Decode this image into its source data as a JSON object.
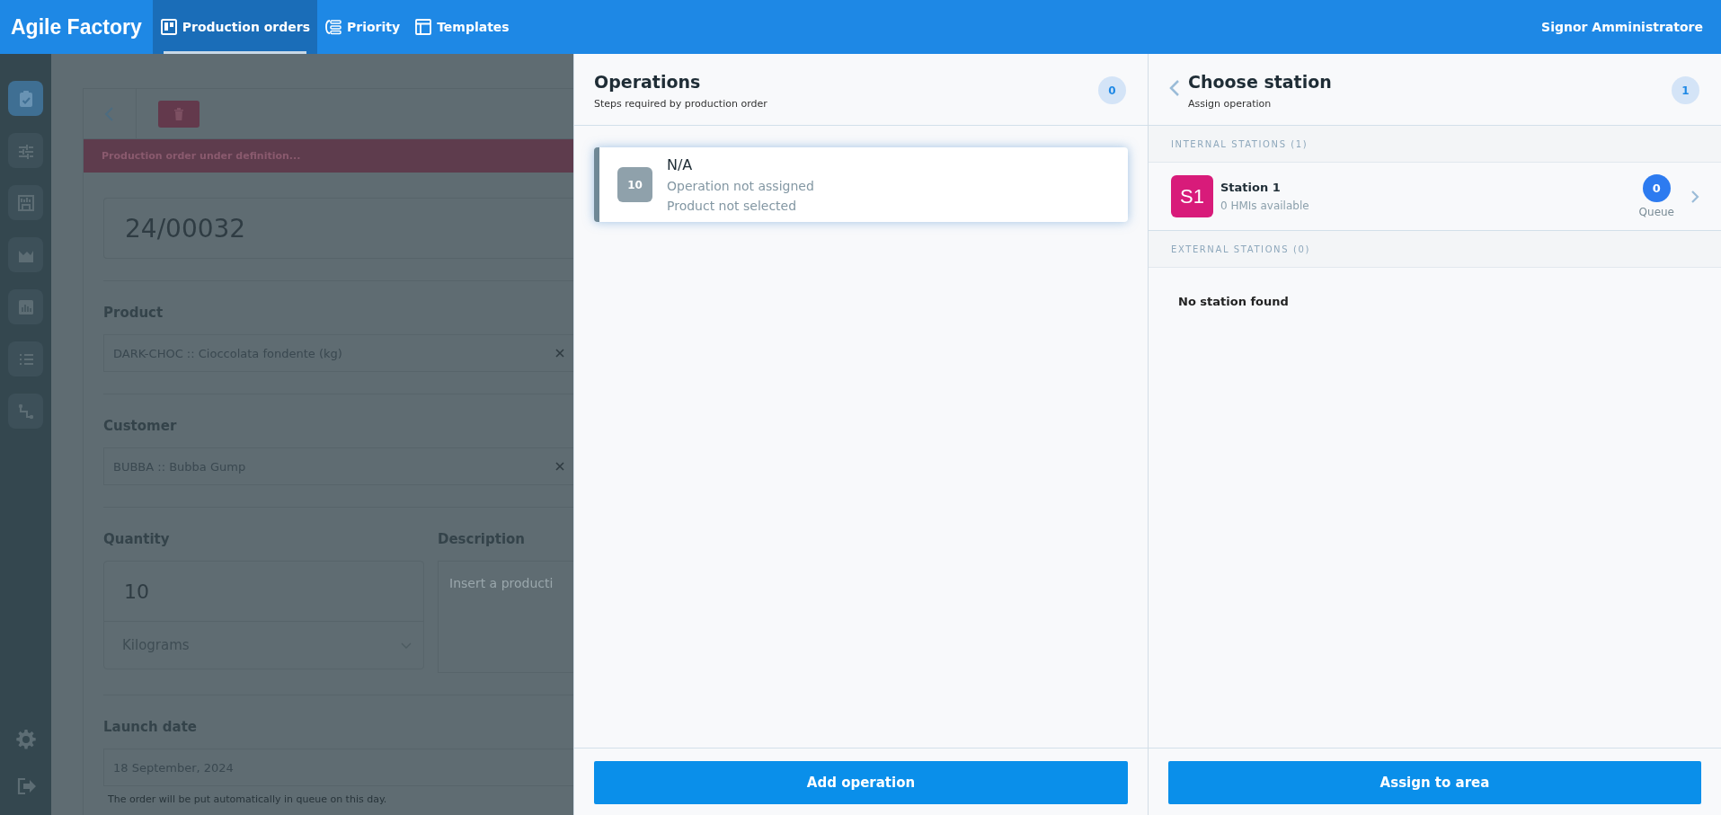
{
  "top_bar": {
    "brand": "Agile Factory",
    "tabs": [
      {
        "label": "Production orders",
        "selected": true
      },
      {
        "label": "Priority",
        "selected": false
      },
      {
        "label": "Templates",
        "selected": false
      }
    ],
    "user": "Signor Amministratore"
  },
  "sidebar": {
    "items": [
      {
        "selected": true
      },
      {
        "selected": false
      },
      {
        "selected": false
      },
      {
        "selected": false
      },
      {
        "selected": false
      },
      {
        "selected": false
      },
      {
        "selected": false
      }
    ]
  },
  "order_form": {
    "status_banner": "Production order under definition...",
    "order_number": "24/00032",
    "product": {
      "label": "Product",
      "value": "DARK-CHOC :: Cioccolata fondente (kg)"
    },
    "customer": {
      "label": "Customer",
      "value": "BUBBA :: Bubba Gump"
    },
    "quantity": {
      "label": "Quantity",
      "value": "10",
      "unit": "Kilograms"
    },
    "description": {
      "label": "Description",
      "placeholder": "Insert a producti"
    },
    "launch_date": {
      "label": "Launch date",
      "value": "18 September, 2024",
      "hint": "The order will be put automatically in queue on this day."
    }
  },
  "operations_panel": {
    "title": "Operations",
    "subtitle": "Steps required by production order",
    "count": "0",
    "operations": [
      {
        "number": "10",
        "title": "N/A",
        "lines": [
          "Operation not assigned",
          "Product not selected"
        ]
      }
    ],
    "button": "Add operation"
  },
  "station_panel": {
    "title": "Choose station",
    "subtitle": "Assign operation",
    "count": "1",
    "groups": [
      {
        "heading": "INTERNAL STATIONS (1)",
        "stations": [
          {
            "badge": "S1",
            "color": "#d81b7a",
            "name": "Station 1",
            "detail": "0 HMIs available",
            "queue_count": "0",
            "queue_label": "Queue"
          }
        ]
      },
      {
        "heading": "EXTERNAL STATIONS (0)",
        "empty_text": "No station found"
      }
    ],
    "button": "Assign to area"
  }
}
